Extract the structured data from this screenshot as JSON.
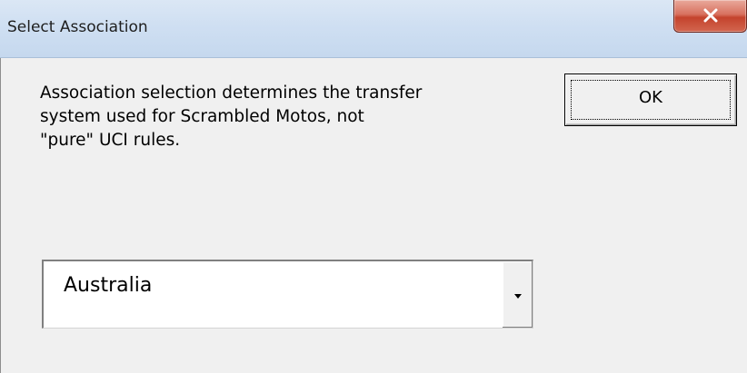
{
  "window": {
    "title": "Select Association",
    "close_icon": "close-x-icon"
  },
  "message": {
    "lines": [
      "Association selection determines the transfer",
      "system used for Scrambled Motos, not",
      "\"pure\" UCI rules."
    ]
  },
  "ok_button": {
    "label": "OK"
  },
  "association_select": {
    "selected_value": "Australia",
    "dropdown_icon": "dropdown-arrow-icon"
  },
  "colors": {
    "titlebar": "#cfdff2",
    "close_button": "#c4432d",
    "background": "#f0f0f0"
  }
}
